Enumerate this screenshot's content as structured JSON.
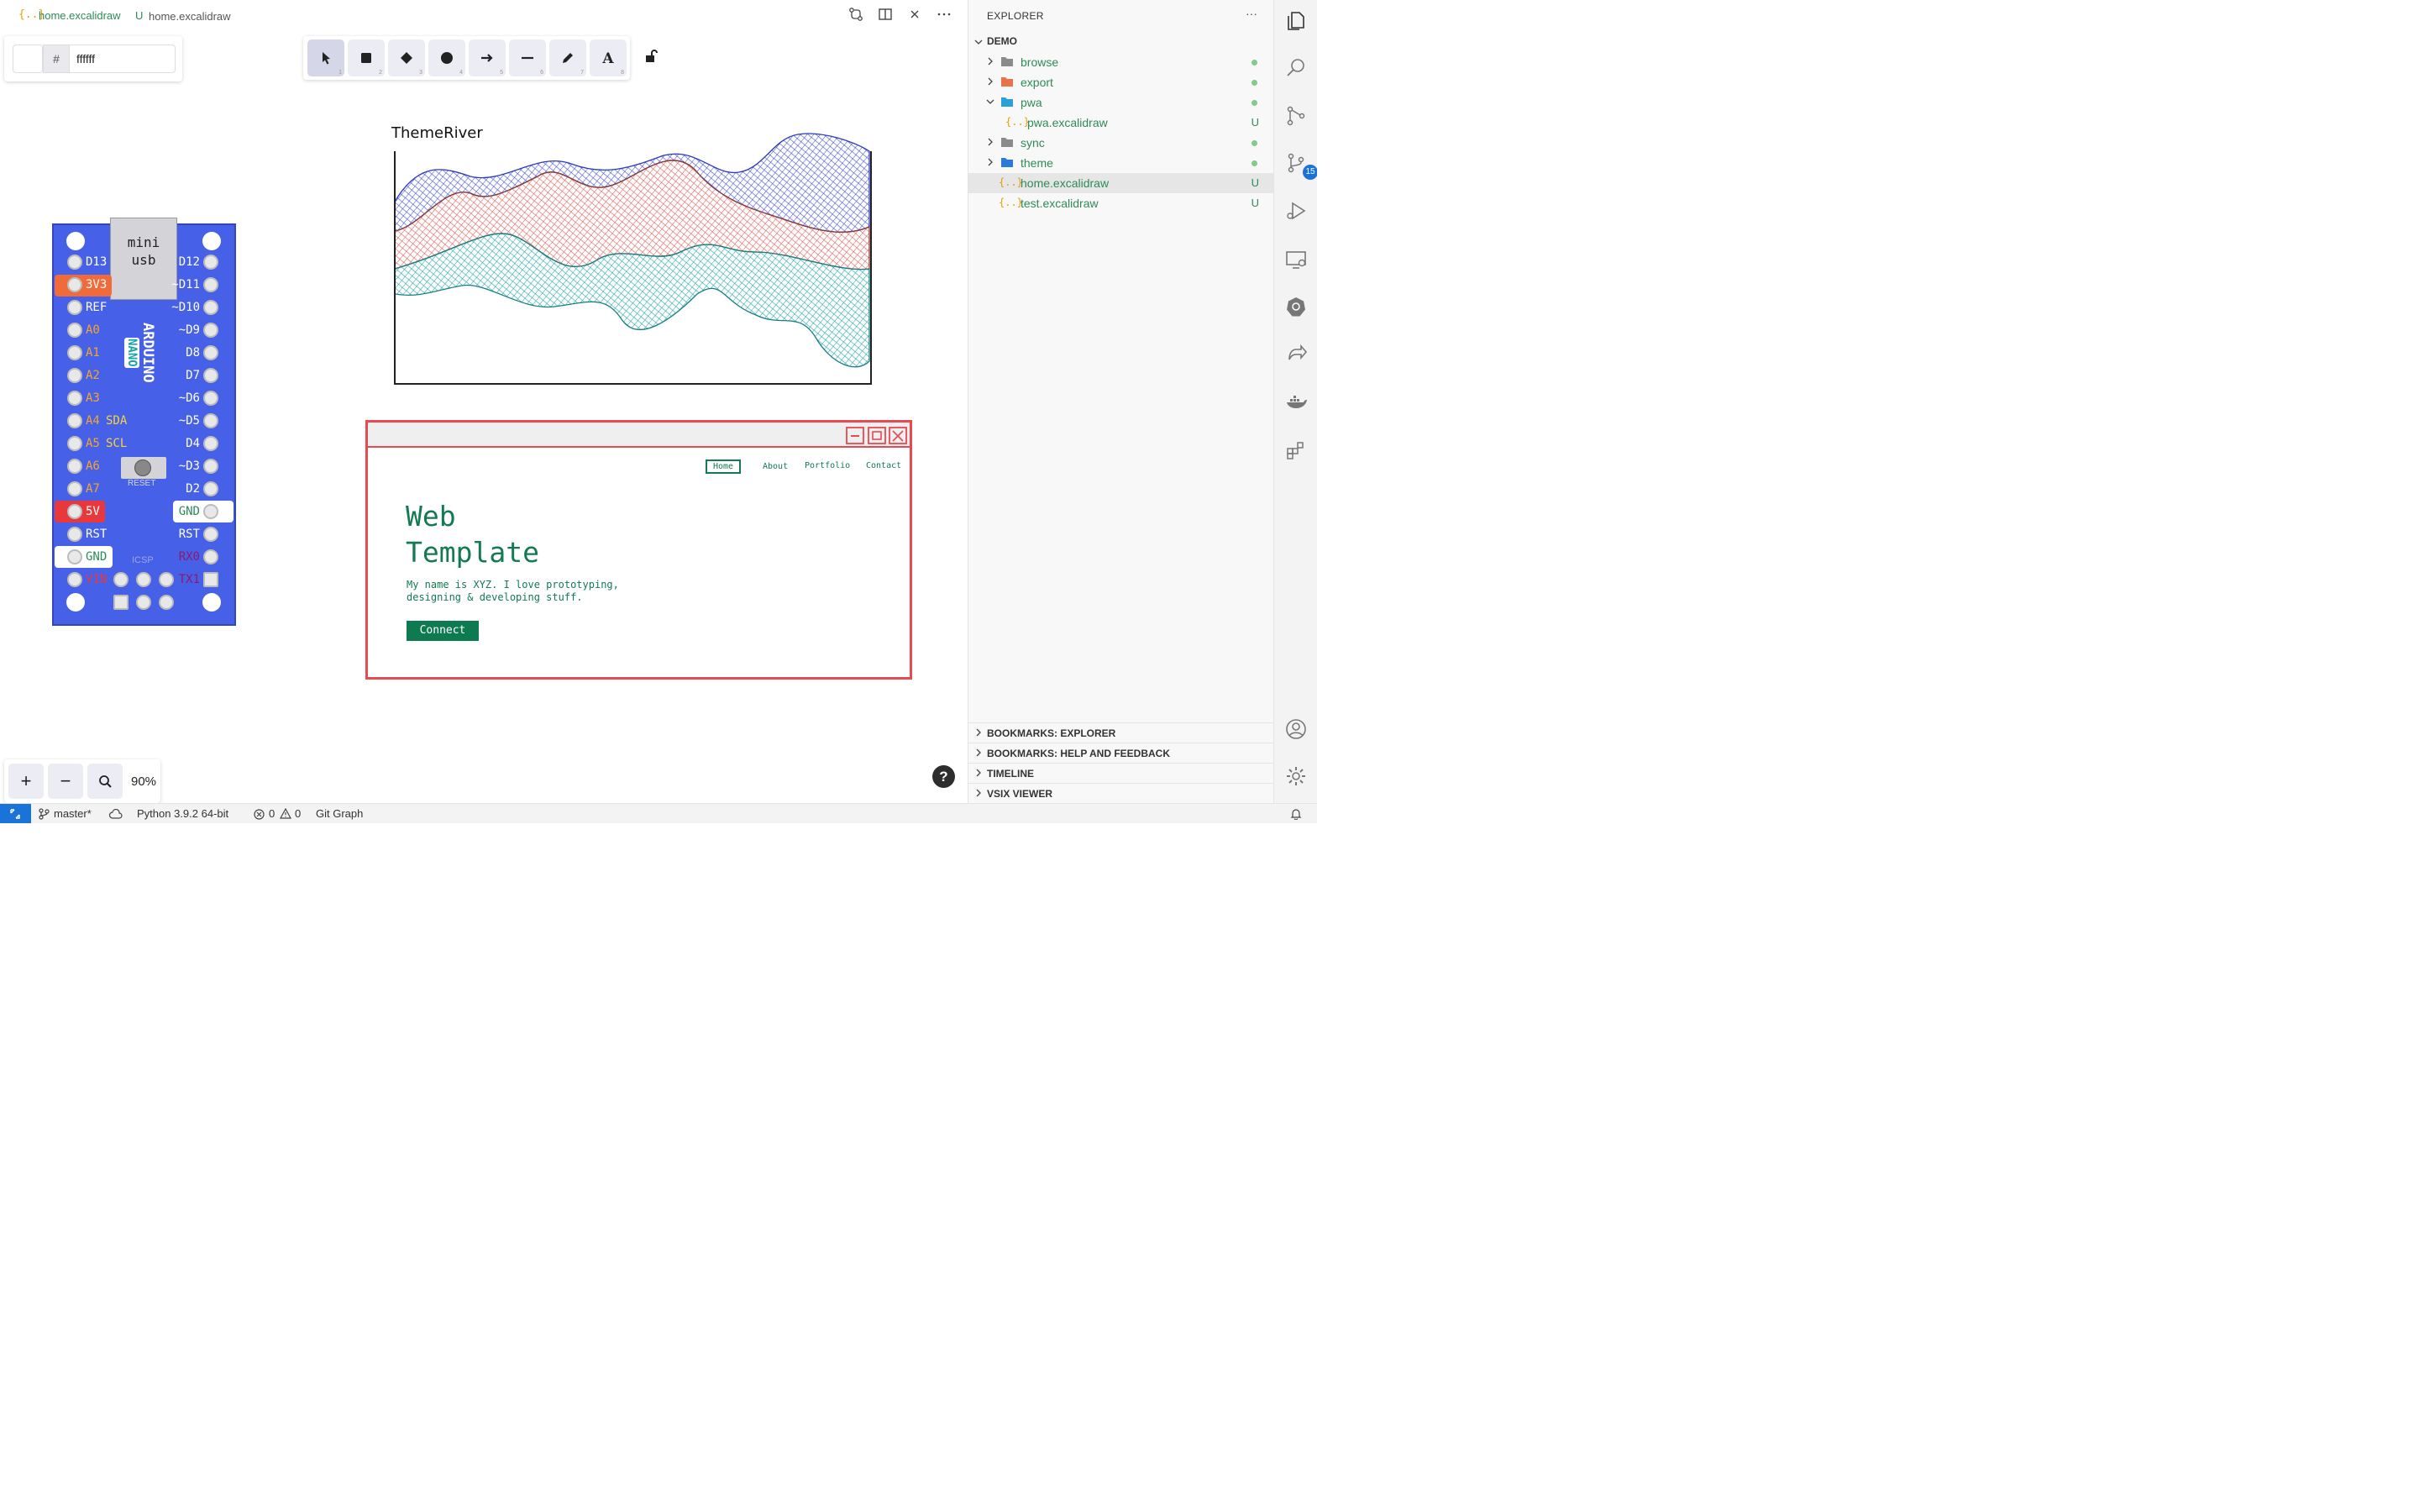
{
  "tab": {
    "icon": "{..}",
    "name": "home.excalidraw",
    "status": "U",
    "path": "home.excalidraw"
  },
  "color_panel": {
    "hash": "#",
    "value": "ffffff"
  },
  "tools": [
    {
      "name": "selection",
      "num": "1"
    },
    {
      "name": "rectangle",
      "num": "2"
    },
    {
      "name": "diamond",
      "num": "3"
    },
    {
      "name": "ellipse",
      "num": "4"
    },
    {
      "name": "arrow",
      "num": "5"
    },
    {
      "name": "line",
      "num": "6"
    },
    {
      "name": "draw",
      "num": "7"
    },
    {
      "name": "text",
      "num": "8"
    }
  ],
  "zoom": {
    "plus": "+",
    "minus": "−",
    "value": "90%"
  },
  "help": "?",
  "canvas": {
    "themeriver_title": "ThemeRiver",
    "arduino": {
      "usb_line1": "mini",
      "usb_line2": "usb",
      "brand": "ARDUINO",
      "model": "NANO",
      "reset": "RESET",
      "icsp": "ICSP",
      "left_pins": [
        "D13",
        "3V3",
        "REF",
        "A0",
        "A1",
        "A2",
        "A3",
        "A4",
        "A5",
        "A6",
        "A7",
        "5V",
        "RST",
        "GND",
        "VIN"
      ],
      "left_extra": {
        "a4": "SDA",
        "a5": "SCL"
      },
      "right_pins": [
        "D12",
        "~D11",
        "~D10",
        "~D9",
        "D8",
        "D7",
        "~D6",
        "~D5",
        "D4",
        "~D3",
        "D2",
        "GND",
        "RST",
        "RX0",
        "TX1"
      ]
    },
    "web_template": {
      "nav": [
        "Home",
        "About",
        "Portfolio",
        "Contact"
      ],
      "title_line1": "Web",
      "title_line2": "Template",
      "desc_line1": "My name is XYZ. I love prototyping,",
      "desc_line2": "designing & developing stuff.",
      "button": "Connect"
    }
  },
  "explorer": {
    "title": "EXPLORER",
    "more": "···",
    "root": "DEMO",
    "items": [
      {
        "label": "browse",
        "type": "folder",
        "status": "dot"
      },
      {
        "label": "export",
        "type": "folder",
        "status": "dot"
      },
      {
        "label": "pwa",
        "type": "folder-open",
        "status": "dot"
      },
      {
        "label": "pwa.excalidraw",
        "type": "file",
        "status": "U"
      },
      {
        "label": "sync",
        "type": "folder",
        "status": "dot"
      },
      {
        "label": "theme",
        "type": "folder",
        "status": "dot"
      },
      {
        "label": "home.excalidraw",
        "type": "file",
        "status": "U"
      },
      {
        "label": "test.excalidraw",
        "type": "file",
        "status": "U"
      }
    ],
    "sections": [
      "BOOKMARKS: EXPLORER",
      "BOOKMARKS: HELP AND FEEDBACK",
      "TIMELINE",
      "VSIX VIEWER"
    ]
  },
  "activity": {
    "scm_badge": "15"
  },
  "statusbar": {
    "branch": "master*",
    "python": "Python 3.9.2 64-bit",
    "errors": "0",
    "warnings": "0",
    "git_graph": "Git Graph"
  },
  "colors": {
    "accent": "#1a73d9",
    "git_green": "#2e8b57",
    "board": "#4760e8",
    "template_red": "#e84a4f",
    "template_green": "#137a52"
  }
}
